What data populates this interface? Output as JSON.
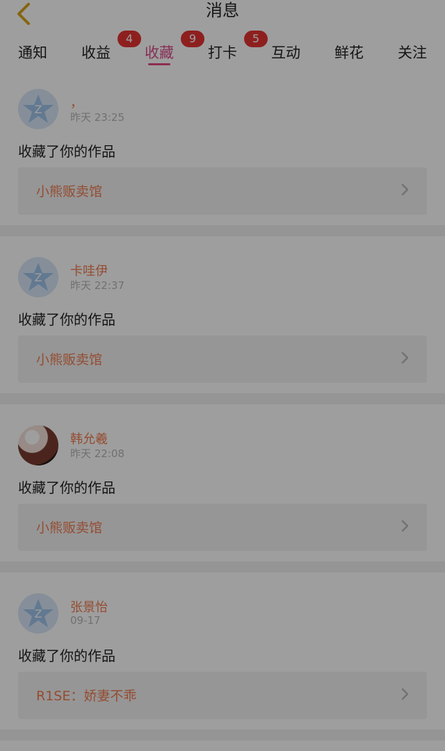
{
  "header": {
    "title": "消息",
    "back_icon": "chevron-left-icon"
  },
  "tabs": [
    {
      "label": "通知",
      "active": false,
      "badge": ""
    },
    {
      "label": "收益",
      "active": false,
      "badge": "4"
    },
    {
      "label": "收藏",
      "active": true,
      "badge": "9"
    },
    {
      "label": "打卡",
      "active": false,
      "badge": "5"
    },
    {
      "label": "互动",
      "active": false,
      "badge": ""
    },
    {
      "label": "鲜花",
      "active": false,
      "badge": ""
    },
    {
      "label": "关注",
      "active": false,
      "badge": ""
    }
  ],
  "notifications": [
    {
      "avatar_icon": "default-avatar-icon",
      "name": "，",
      "time": "昨天 23:25",
      "action": "收藏了你的作品",
      "work_title": "小熊贩卖馆"
    },
    {
      "avatar_icon": "default-avatar-icon",
      "name": "卡哇伊",
      "time": "昨天 22:37",
      "action": "收藏了你的作品",
      "work_title": "小熊贩卖馆"
    },
    {
      "avatar_icon": "user-photo-avatar",
      "name": "韩允羲",
      "time": "昨天 22:08",
      "action": "收藏了你的作品",
      "work_title": "小熊贩卖馆"
    },
    {
      "avatar_icon": "default-avatar-icon",
      "name": "张景怡",
      "time": "09-17",
      "action": "收藏了你的作品",
      "work_title": "R1SE：娇妻不乖"
    }
  ],
  "colors": {
    "accent_pink": "#e24a84",
    "name_orange": "#ef7b4f",
    "badge_red": "#e53333",
    "overlay": "rgba(0,0,0,0.38)"
  }
}
